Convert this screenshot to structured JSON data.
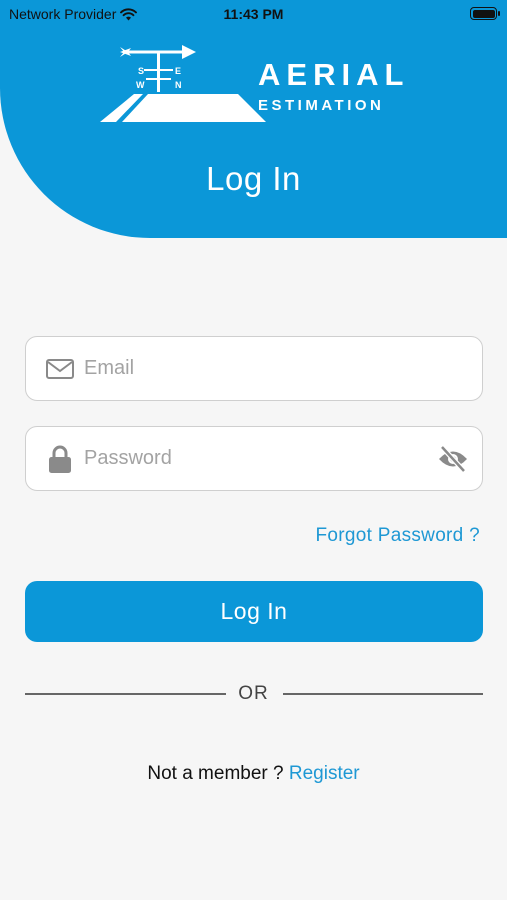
{
  "status_bar": {
    "carrier": "Network Provider",
    "time": "11:43 PM"
  },
  "logo": {
    "title": "AERIAL",
    "subtitle": "ESTIMATION",
    "compass": {
      "s": "S",
      "e": "E",
      "w": "W",
      "n": "N"
    }
  },
  "page": {
    "title": "Log In"
  },
  "form": {
    "email": {
      "placeholder": "Email",
      "value": ""
    },
    "password": {
      "placeholder": "Password",
      "value": ""
    },
    "forgot_label": "Forgot Password ?",
    "login_label": "Log In"
  },
  "divider_label": "OR",
  "register": {
    "prompt": "Not a member ?",
    "link_label": "Register"
  },
  "colors": {
    "brand": "#0b97d8",
    "link": "#1e98d4",
    "background": "#f6f6f6"
  },
  "icons": [
    "wifi-icon",
    "battery-icon",
    "mail-icon",
    "lock-icon",
    "eye-off-icon"
  ]
}
